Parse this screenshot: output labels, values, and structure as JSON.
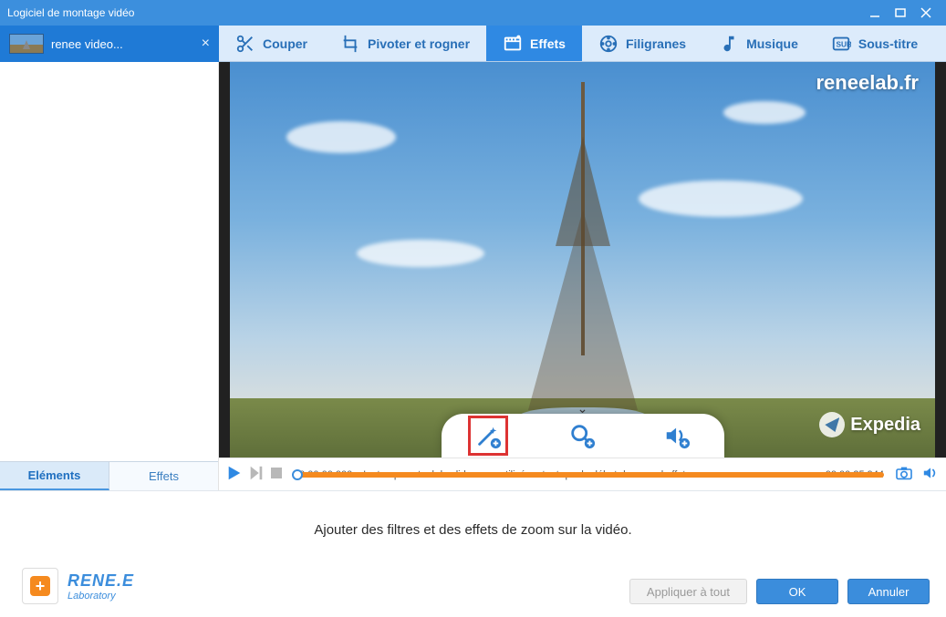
{
  "window": {
    "title": "Logiciel de montage vidéo"
  },
  "file_tab": {
    "name": "renee video...",
    "close": "×"
  },
  "toolbar": [
    {
      "id": "cut",
      "label": "Couper"
    },
    {
      "id": "rotate",
      "label": "Pivoter et rogner"
    },
    {
      "id": "effects",
      "label": "Effets",
      "active": true
    },
    {
      "id": "wm",
      "label": "Filigranes"
    },
    {
      "id": "music",
      "label": "Musique"
    },
    {
      "id": "subtitle",
      "label": "Sous-titre"
    }
  ],
  "side_tabs": {
    "elements": "Eléments",
    "effects": "Effets"
  },
  "watermarks": {
    "top_right": "reneelab.fr",
    "bottom_right": "Expedia"
  },
  "popover": {
    "wand": "add-filter",
    "zoom": "add-zoom",
    "audio": "add-audio"
  },
  "timeline": {
    "start": "00:00:00.000",
    "end": "00:00:35.944",
    "hint": "Le temps actuel du slider sera utilisé en tant que le début du nouvel effet."
  },
  "bottom": {
    "info": "Ajouter des filtres et des effets de zoom sur la vidéo.",
    "logo_line1": "RENE.E",
    "logo_line2": "Laboratory",
    "apply_all": "Appliquer à tout",
    "ok": "OK",
    "cancel": "Annuler"
  }
}
